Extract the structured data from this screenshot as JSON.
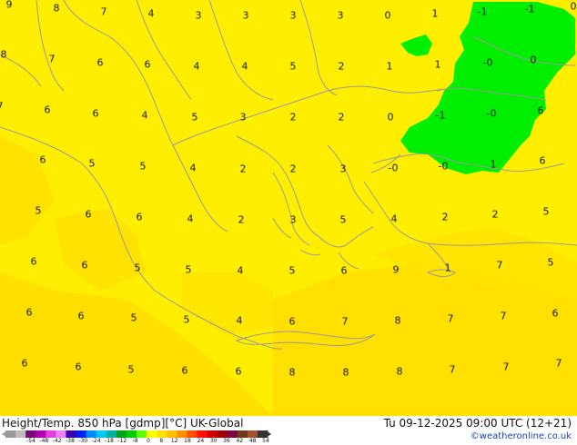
{
  "map": {
    "title_left": "Height/Temp. 850 hPa [gdmp][°C] UK-Global",
    "title_right": "Tu 09-12-2025 09:00 UTC (12+21)",
    "copyright": "©weatheronline.co.uk",
    "colors": {
      "land_yellow": "#ffee00",
      "warm_yellow": "#ffdd00",
      "green_zone": "#00ee00",
      "coast": "#9b9b9b"
    },
    "labels": [
      {
        "t": "9"
      },
      {
        "t": "8"
      },
      {
        "t": "7"
      },
      {
        "t": "4"
      },
      {
        "t": "3"
      },
      {
        "t": "3"
      },
      {
        "t": "3"
      },
      {
        "t": "3"
      },
      {
        "t": "0"
      },
      {
        "t": "1"
      },
      {
        "t": "-1"
      },
      {
        "t": "-1"
      },
      {
        "t": "0"
      },
      {
        "t": "8"
      },
      {
        "t": "7"
      },
      {
        "t": "6"
      },
      {
        "t": "6"
      },
      {
        "t": "4"
      },
      {
        "t": "4"
      },
      {
        "t": "5"
      },
      {
        "t": "2"
      },
      {
        "t": "1"
      },
      {
        "t": "1"
      },
      {
        "t": "-0"
      },
      {
        "t": "0"
      },
      {
        "t": "7"
      },
      {
        "t": "6"
      },
      {
        "t": "6"
      },
      {
        "t": "4"
      },
      {
        "t": "5"
      },
      {
        "t": "3"
      },
      {
        "t": "2"
      },
      {
        "t": "2"
      },
      {
        "t": "0"
      },
      {
        "t": "-1"
      },
      {
        "t": "-0"
      },
      {
        "t": "6"
      },
      {
        "t": "6"
      },
      {
        "t": "5"
      },
      {
        "t": "5"
      },
      {
        "t": "4"
      },
      {
        "t": "2"
      },
      {
        "t": "2"
      },
      {
        "t": "3"
      },
      {
        "t": "-0"
      },
      {
        "t": "-0"
      },
      {
        "t": "1"
      },
      {
        "t": "6"
      },
      {
        "t": "5"
      },
      {
        "t": "6"
      },
      {
        "t": "6"
      },
      {
        "t": "4"
      },
      {
        "t": "2"
      },
      {
        "t": "3"
      },
      {
        "t": "5"
      },
      {
        "t": "4"
      },
      {
        "t": "2"
      },
      {
        "t": "2"
      },
      {
        "t": "5"
      },
      {
        "t": "6"
      },
      {
        "t": "6"
      },
      {
        "t": "5"
      },
      {
        "t": "5"
      },
      {
        "t": "4"
      },
      {
        "t": "5"
      },
      {
        "t": "6"
      },
      {
        "t": "9"
      },
      {
        "t": "1"
      },
      {
        "t": "7"
      },
      {
        "t": "5"
      },
      {
        "t": "6"
      },
      {
        "t": "6"
      },
      {
        "t": "5"
      },
      {
        "t": "5"
      },
      {
        "t": "4"
      },
      {
        "t": "6"
      },
      {
        "t": "7"
      },
      {
        "t": "8"
      },
      {
        "t": "7"
      },
      {
        "t": "7"
      },
      {
        "t": "6"
      },
      {
        "t": "6"
      },
      {
        "t": "6"
      },
      {
        "t": "5"
      },
      {
        "t": "6"
      },
      {
        "t": "6"
      },
      {
        "t": "8"
      },
      {
        "t": "8"
      },
      {
        "t": "8"
      },
      {
        "t": "7"
      },
      {
        "t": "7"
      },
      {
        "t": "7"
      },
      {
        "t": "8"
      },
      {
        "t": "7"
      }
    ],
    "colorbar": {
      "colors": [
        "#9a9a9a",
        "#bdbdbd",
        "#7a0a7a",
        "#b000b0",
        "#e040e0",
        "#f080f0",
        "#3a00b0",
        "#0020f0",
        "#0088ff",
        "#00c8ff",
        "#00b0a0",
        "#00a020",
        "#00cc00",
        "#60ff00",
        "#ffff00",
        "#ffe000",
        "#ffc000",
        "#ff9000",
        "#ff5000",
        "#ff1000",
        "#d00000",
        "#a00000",
        "#800040",
        "#6b3b1b",
        "#a0522d",
        "#333333"
      ],
      "ticks": [
        "-54",
        "-48",
        "-42",
        "-38",
        "-30",
        "-24",
        "-18",
        "-12",
        "-8",
        "0",
        "8",
        "12",
        "18",
        "24",
        "30",
        "36",
        "42",
        "48",
        "54"
      ]
    }
  }
}
